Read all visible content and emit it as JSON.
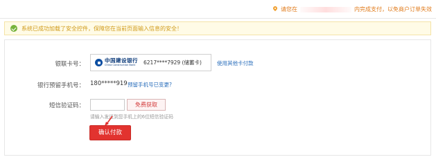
{
  "top_tip": {
    "text_start": "请您在",
    "text_end": "内完成支付，以免商户订单失效"
  },
  "notice": {
    "text": "系统已成功加载了安全控件，保障您在当前页面输入信息的安全！"
  },
  "form": {
    "card_label": "银联卡号：",
    "bank_name": "中国建设银行",
    "bank_name_en": "China Construction Bank",
    "card_number": "6217****7929 (储蓄卡)",
    "other_card_link": "使用其他卡付款",
    "phone_label": "银行预留手机号：",
    "phone_value": "180*****919",
    "phone_changed_link": "预留手机号已变更?",
    "sms_label": "短信验证码：",
    "sms_input_value": "",
    "get_code_button": "免费获取",
    "sms_hint": "请输入发送到您手机上的6位短信验证码",
    "confirm_button": "确认付款"
  },
  "colors": {
    "accent_red": "#e2332f",
    "link_blue": "#2a6ebb",
    "notice_text": "#d09b1b",
    "success_green": "#77b33b"
  }
}
